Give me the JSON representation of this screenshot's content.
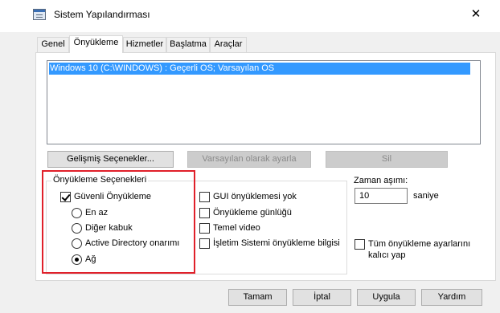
{
  "window": {
    "title": "Sistem Yapılandırması",
    "icon": "msconfig-icon",
    "close_glyph": "✕"
  },
  "tabs": [
    {
      "label": "Genel",
      "active": false
    },
    {
      "label": "Önyükleme",
      "active": true
    },
    {
      "label": "Hizmetler",
      "active": false
    },
    {
      "label": "Başlatma",
      "active": false
    },
    {
      "label": "Araçlar",
      "active": false
    }
  ],
  "os_list": {
    "items": [
      "Windows 10 (C:\\WINDOWS) : Geçerli OS; Varsayılan OS"
    ],
    "selected_index": 0
  },
  "os_buttons": {
    "advanced": "Gelişmiş Seçenekler...",
    "set_default": "Varsayılan olarak ayarla",
    "delete": "Sil"
  },
  "boot_options": {
    "title": "Önyükleme Seçenekleri",
    "safe_boot": {
      "label": "Güvenli Önyükleme",
      "checked": true
    },
    "modes": [
      {
        "label": "En az",
        "checked": false
      },
      {
        "label": "Diğer kabuk",
        "checked": false
      },
      {
        "label": "Active Directory onarımı",
        "checked": false
      },
      {
        "label": "Ağ",
        "checked": true
      }
    ],
    "flags": [
      {
        "label": "GUI önyüklemesi yok",
        "checked": false
      },
      {
        "label": "Önyükleme günlüğü",
        "checked": false
      },
      {
        "label": "Temel video",
        "checked": false
      },
      {
        "label": "İşletim Sistemi önyükleme bilgisi",
        "checked": false
      }
    ]
  },
  "timeout": {
    "label": "Zaman aşımı:",
    "value": "10",
    "unit": "saniye"
  },
  "permanent": {
    "label_line1": "Tüm önyükleme ayarlarını",
    "label_line2": "kalıcı yap",
    "checked": false
  },
  "footer_buttons": {
    "ok": "Tamam",
    "cancel": "İptal",
    "apply": "Uygula",
    "help": "Yardım"
  },
  "colors": {
    "selection": "#3399ff",
    "annotation_box": "#e0202a",
    "dialog_bg": "#f0f0f0"
  }
}
